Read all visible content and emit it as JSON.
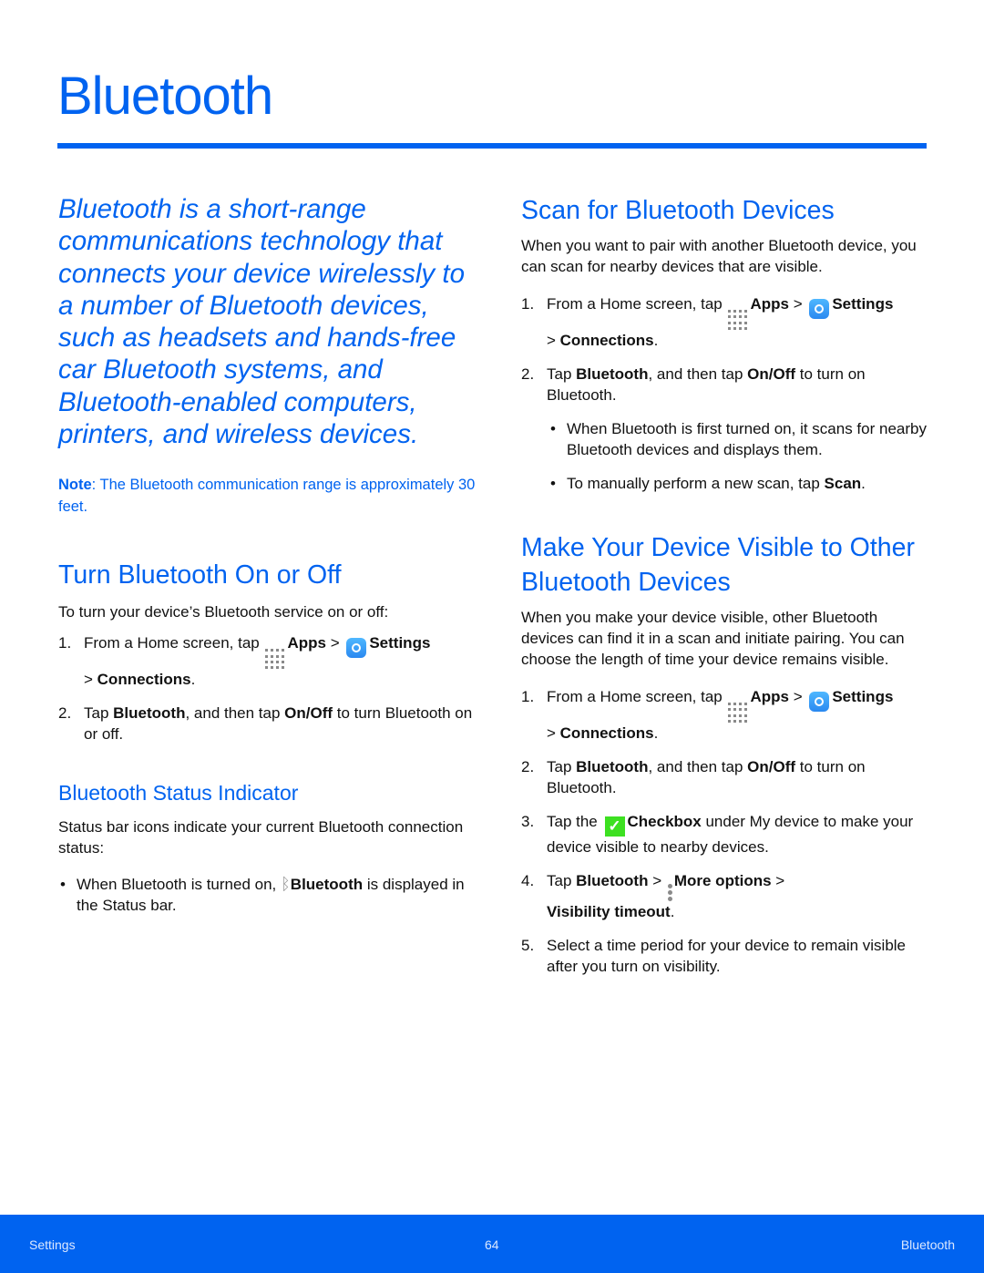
{
  "page": {
    "title": "Bluetooth",
    "accent_color": "#0063f0"
  },
  "left": {
    "intro": "Bluetooth is a short-range communications technology that connects your device wirelessly to a number of Bluetooth devices, such as headsets and hands-free car Bluetooth systems, and Bluetooth-enabled computers, printers, and wireless devices.",
    "note_label": "Note",
    "note_text": ": The Bluetooth communication range is approximately 30 feet.",
    "turn_on_off": {
      "heading": "Turn Bluetooth On or Off",
      "lead": "To turn your device’s Bluetooth service on or off:",
      "step1": {
        "num": "1.",
        "a": "From a Home screen, tap ",
        "apps": "Apps",
        "sep": " > ",
        "settings": "Settings",
        "b": "> ",
        "connections": "Connections",
        "end": "."
      },
      "step2": {
        "num": "2.",
        "a": "Tap ",
        "bt": "Bluetooth",
        "b": ", and then tap ",
        "onoff": "On/Off",
        "c": " to turn Bluetooth on or off."
      }
    },
    "status": {
      "heading": "Bluetooth Status Indicator",
      "lead": "Status bar icons indicate your current Bluetooth connection status:",
      "bullet": {
        "dot": "•",
        "a": "When Bluetooth is turned on, ",
        "bt": "Bluetooth",
        "b": " is displayed in the Status bar."
      }
    }
  },
  "right": {
    "scan": {
      "heading": "Scan for Bluetooth Devices",
      "lead": "When you want to pair with another Bluetooth device, you can scan for nearby devices that are visible.",
      "step1": {
        "num": "1.",
        "a": "From a Home screen, tap ",
        "apps": "Apps",
        "sep": " > ",
        "settings": "Settings",
        "b": "> ",
        "connections": "Connections",
        "end": "."
      },
      "step2": {
        "num": "2.",
        "a": "Tap ",
        "bt": "Bluetooth",
        "b": ", and then tap ",
        "onoff": "On/Off",
        "c": " to turn on Bluetooth."
      },
      "bullet1": {
        "dot": "•",
        "text": "When Bluetooth is first turned on, it scans for nearby Bluetooth devices and displays them."
      },
      "bullet2": {
        "dot": "•",
        "a": "To manually perform a new scan, tap ",
        "scan": "Scan",
        "end": "."
      }
    },
    "visible": {
      "heading": "Make Your Device Visible to Other Bluetooth Devices",
      "lead": "When you make your device visible, other Bluetooth devices can find it in a scan and initiate pairing. You can choose the length of time your device remains visible.",
      "step1": {
        "num": "1.",
        "a": "From a Home screen, tap ",
        "apps": "Apps",
        "sep": " > ",
        "settings": "Settings",
        "b": "> ",
        "connections": "Connections",
        "end": "."
      },
      "step2": {
        "num": "2.",
        "a": "Tap ",
        "bt": "Bluetooth",
        "b": ", and then tap ",
        "onoff": "On/Off",
        "c": " to turn on Bluetooth."
      },
      "step3": {
        "num": "3.",
        "a": "Tap the ",
        "checkbox": "Checkbox",
        "b": " under My device to make your device visible to nearby devices."
      },
      "step4": {
        "num": "4.",
        "a": "Tap ",
        "bt": "Bluetooth",
        "sep": " > ",
        "more": "More options",
        "sep2": " > ",
        "vis": "Visibility timeout",
        "end": "."
      },
      "step5": {
        "num": "5.",
        "text": "Select a time period for your device to remain visible after you turn on visibility."
      }
    }
  },
  "footer": {
    "left": "Settings",
    "page": "64",
    "right": "Bluetooth"
  },
  "icons": {
    "apps": "apps-grid-icon",
    "settings": "settings-gear-icon",
    "bluetooth": "bluetooth-icon",
    "checkbox": "checkbox-icon",
    "more": "more-options-icon"
  }
}
